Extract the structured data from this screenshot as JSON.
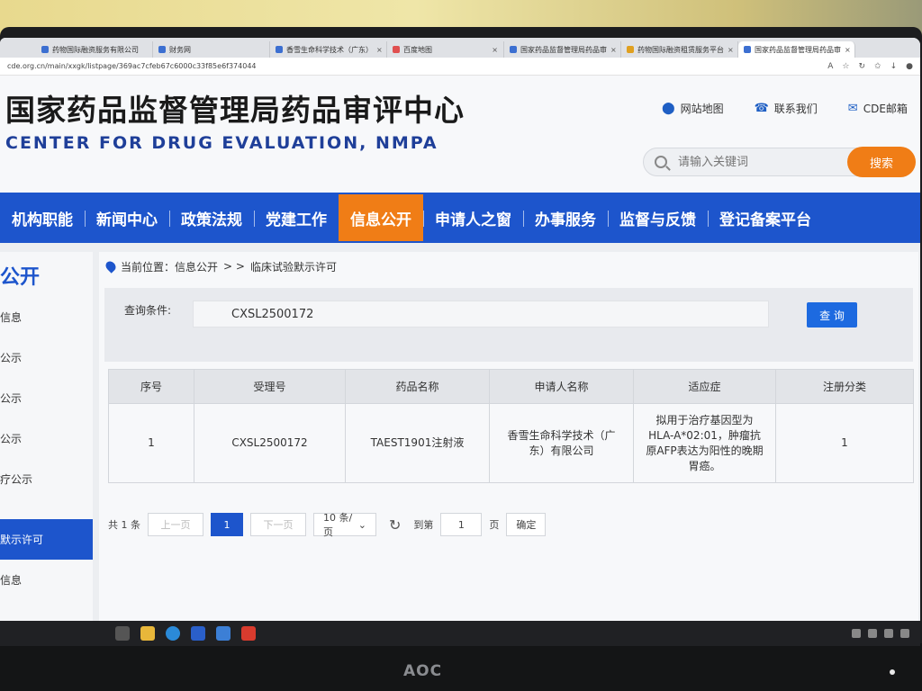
{
  "browser": {
    "tabs": [
      {
        "label": "药物国际融资服务有限公司"
      },
      {
        "label": "财务网"
      },
      {
        "label": "香雪生命科学技术（广东）"
      },
      {
        "label": "百度地图"
      },
      {
        "label": "国家药品监督管理局药品审"
      },
      {
        "label": "药物国际融资租赁服务平台"
      },
      {
        "label": "国家药品监督管理局药品审"
      }
    ],
    "url": "cde.org.cn/main/xxgk/listpage/369ac7cfeb67c6000c33f85e6f374044"
  },
  "header": {
    "title_cn": "国家药品监督管理局药品审评中心",
    "title_en": "CENTER FOR DRUG EVALUATION, NMPA",
    "links": {
      "sitemap": "网站地图",
      "contact": "联系我们",
      "mail": "CDE邮箱"
    },
    "search": {
      "placeholder": "请输入关键词",
      "button": "搜索"
    }
  },
  "nav": {
    "items": [
      "机构职能",
      "新闻中心",
      "政策法规",
      "党建工作",
      "信息公开",
      "申请人之窗",
      "办事服务",
      "监督与反馈",
      "登记备案平台"
    ],
    "active_index": 4
  },
  "sidebar": {
    "title": "公开",
    "items": [
      "信息",
      "公示",
      "公示",
      "公示",
      "疗公示"
    ],
    "active": "默示许可",
    "after": "信息"
  },
  "breadcrumb": {
    "prefix": "当前位置：信息公开",
    "sep": "> >",
    "current": "临床试验默示许可"
  },
  "query": {
    "label": "查询条件:",
    "value": "CXSL2500172",
    "button": "查 询"
  },
  "table": {
    "headers": [
      "序号",
      "受理号",
      "药品名称",
      "申请人名称",
      "适应症",
      "注册分类"
    ],
    "rows": [
      [
        "1",
        "CXSL2500172",
        "TAEST1901注射液",
        "香雪生命科学技术（广东）有限公司",
        "拟用于治疗基因型为HLA-A*02:01，肿瘤抗原AFP表达为阳性的晚期胃癌。",
        "1"
      ]
    ]
  },
  "pager": {
    "total": "共 1 条",
    "prev": "上一页",
    "current": "1",
    "next": "下一页",
    "page_size": "10 条/页",
    "goto_label": "到第",
    "goto_value": "1",
    "page_unit": "页",
    "confirm": "确定"
  },
  "monitor": {
    "brand": "AOC"
  }
}
